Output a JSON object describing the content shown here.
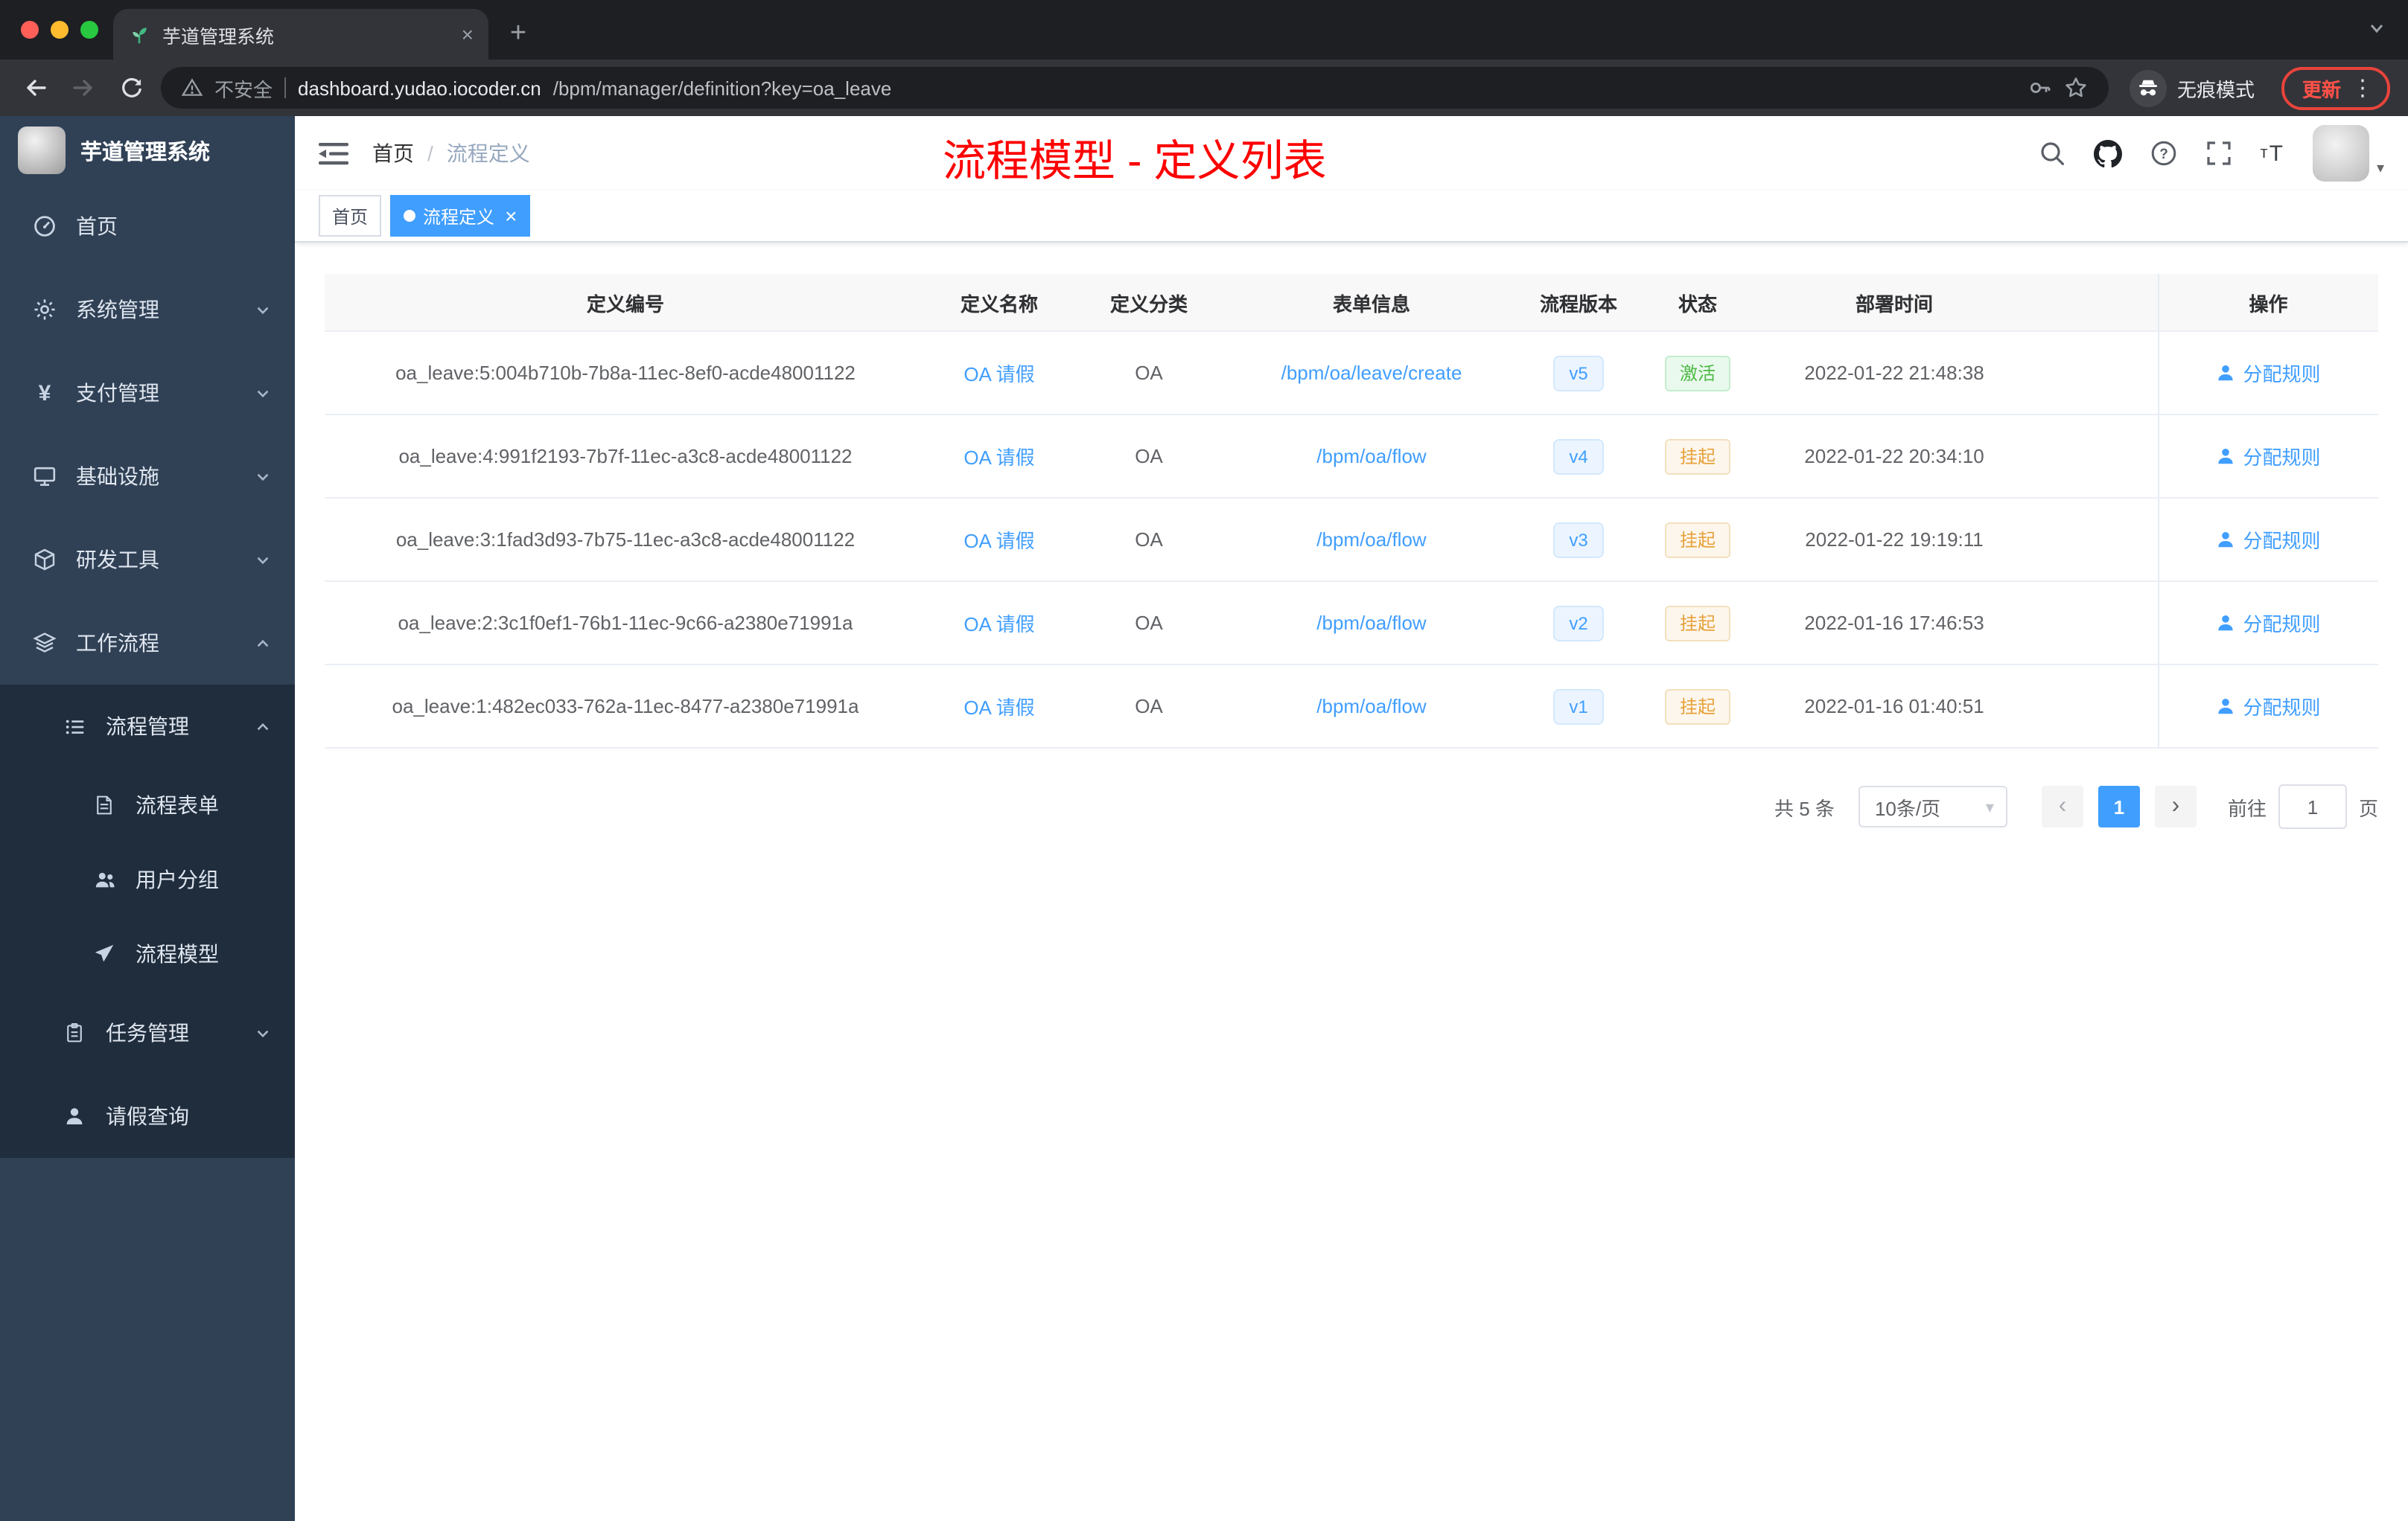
{
  "browser": {
    "tab_title": "芋道管理系统",
    "security_label": "不安全",
    "url_host": "dashboard.yudao.iocoder.cn",
    "url_path": "/bpm/manager/definition?key=oa_leave",
    "incognito_label": "无痕模式",
    "update_label": "更新"
  },
  "icons": {
    "close": "×",
    "plus": "+",
    "prev": "‹",
    "next": "›",
    "caret_down": "▾",
    "dots": "⋮",
    "slash": "/"
  },
  "sidebar": {
    "logo_title": "芋道管理系统",
    "items": [
      {
        "label": "首页"
      },
      {
        "label": "系统管理"
      },
      {
        "label": "支付管理"
      },
      {
        "label": "基础设施"
      },
      {
        "label": "研发工具"
      },
      {
        "label": "工作流程"
      },
      {
        "label": "流程管理"
      },
      {
        "label": "流程表单"
      },
      {
        "label": "用户分组"
      },
      {
        "label": "流程模型"
      },
      {
        "label": "任务管理"
      },
      {
        "label": "请假查询"
      }
    ]
  },
  "header": {
    "breadcrumb_home": "首页",
    "breadcrumb_current": "流程定义",
    "annotation": "流程模型 - 定义列表"
  },
  "tags": {
    "home": "首页",
    "active": "流程定义"
  },
  "table": {
    "columns": [
      "定义编号",
      "定义名称",
      "定义分类",
      "表单信息",
      "流程版本",
      "状态",
      "部署时间",
      "操作"
    ],
    "rows": [
      {
        "id": "oa_leave:5:004b710b-7b8a-11ec-8ef0-acde48001122",
        "name": "OA 请假",
        "category": "OA",
        "form": "/bpm/oa/leave/create",
        "version": "v5",
        "status": "激活",
        "deployed": "2022-01-22 21:48:38",
        "action": "分配规则"
      },
      {
        "id": "oa_leave:4:991f2193-7b7f-11ec-a3c8-acde48001122",
        "name": "OA 请假",
        "category": "OA",
        "form": "/bpm/oa/flow",
        "version": "v4",
        "status": "挂起",
        "deployed": "2022-01-22 20:34:10",
        "action": "分配规则"
      },
      {
        "id": "oa_leave:3:1fad3d93-7b75-11ec-a3c8-acde48001122",
        "name": "OA 请假",
        "category": "OA",
        "form": "/bpm/oa/flow",
        "version": "v3",
        "status": "挂起",
        "deployed": "2022-01-22 19:19:11",
        "action": "分配规则"
      },
      {
        "id": "oa_leave:2:3c1f0ef1-76b1-11ec-9c66-a2380e71991a",
        "name": "OA 请假",
        "category": "OA",
        "form": "/bpm/oa/flow",
        "version": "v2",
        "status": "挂起",
        "deployed": "2022-01-16 17:46:53",
        "action": "分配规则"
      },
      {
        "id": "oa_leave:1:482ec033-762a-11ec-8477-a2380e71991a",
        "name": "OA 请假",
        "category": "OA",
        "form": "/bpm/oa/flow",
        "version": "v1",
        "status": "挂起",
        "deployed": "2022-01-16 01:40:51",
        "action": "分配规则"
      }
    ]
  },
  "pagination": {
    "total": "共 5 条",
    "page_size": "10条/页",
    "page": "1",
    "goto_label": "前往",
    "goto_value": "1",
    "page_unit": "页"
  },
  "colors": {
    "accent": "#409eff",
    "annotation_red": "#fd0000",
    "status_active_green": "#4fb946",
    "status_suspend_orange": "#e6a23c",
    "sidebar_bg": "#304156",
    "sidebar_submenu_bg": "#1f2d3d"
  }
}
